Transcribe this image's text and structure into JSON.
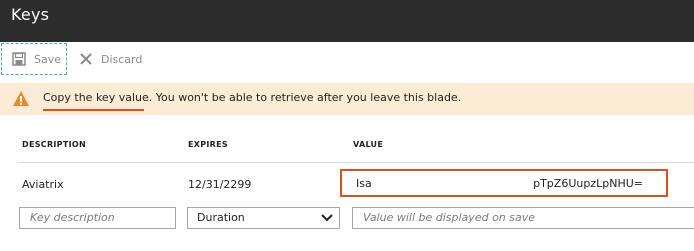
{
  "blade": {
    "title": "Keys"
  },
  "toolbar": {
    "save_label": "Save",
    "discard_label": "Discard",
    "save_icon": "save-icon",
    "discard_icon": "close-icon"
  },
  "banner": {
    "icon": "warning-icon",
    "message": "Copy the key value. You won't be able to retrieve after you leave this blade.",
    "color": "#fcecd5",
    "highlight_color": "#d9521d"
  },
  "table": {
    "headers": {
      "description": "DESCRIPTION",
      "expires": "EXPIRES",
      "value": "VALUE"
    },
    "rows": [
      {
        "description": "Aviatrix",
        "expires": "12/31/2299",
        "value_start": "Isa",
        "value_end": "pTpZ6UupzLpNHU="
      }
    ],
    "new_row": {
      "description_placeholder": "Key description",
      "duration_value": "Duration",
      "value_placeholder": "Value will be displayed on save"
    }
  }
}
